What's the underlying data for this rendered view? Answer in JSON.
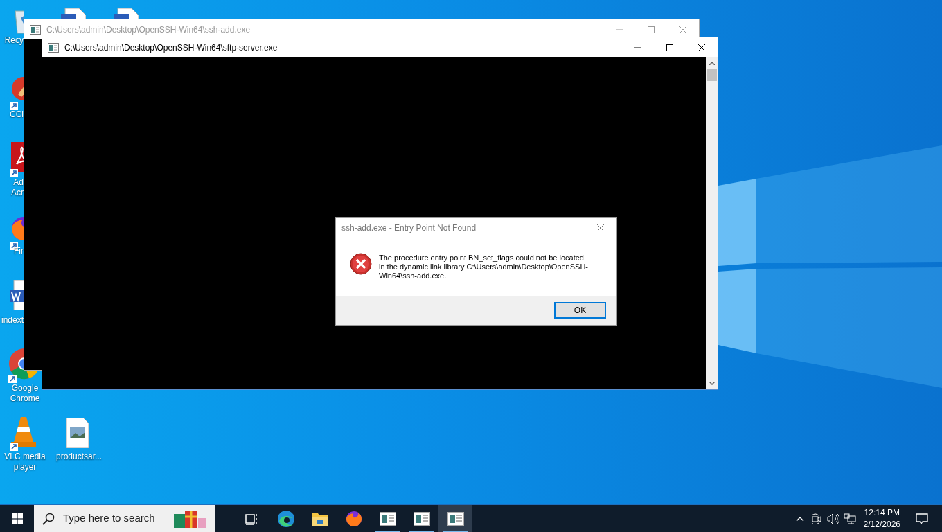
{
  "desktop_icons": [
    {
      "label": "Recy",
      "kind": "recycle",
      "shortcut": false
    },
    {
      "label": "CCl",
      "kind": "ccleaner",
      "shortcut": true
    },
    {
      "label": "Ad Acr",
      "kind": "acrobat",
      "shortcut": true
    },
    {
      "label": "Fir",
      "kind": "firefox",
      "shortcut": true
    },
    {
      "label": "indext",
      "kind": "word",
      "shortcut": false
    },
    {
      "label": "Google Chrome",
      "kind": "chrome",
      "shortcut": true
    },
    {
      "label": "VLC media player",
      "kind": "vlc",
      "shortcut": true
    },
    {
      "label": "productsar...",
      "kind": "image",
      "shortcut": false
    },
    {
      "kind": "worddoc",
      "shortcut": false
    },
    {
      "kind": "worddoc",
      "shortcut": false
    }
  ],
  "windows": [
    {
      "title": "C:\\Users\\admin\\Desktop\\OpenSSH-Win64\\ssh-add.exe",
      "active": false
    },
    {
      "title": "C:\\Users\\admin\\Desktop\\OpenSSH-Win64\\sftp-server.exe",
      "active": true
    }
  ],
  "dialog": {
    "title": "ssh-add.exe - Entry Point Not Found",
    "message": "The procedure entry point BN_set_flags could not be located in the dynamic link library C:\\Users\\admin\\Desktop\\OpenSSH-Win64\\ssh-add.exe.",
    "button": "OK"
  },
  "taskbar": {
    "search": {
      "placeholder": "Type here to search"
    },
    "apps": [
      {
        "kind": "taskview",
        "active": false,
        "running": false
      },
      {
        "kind": "edge",
        "active": false,
        "running": false
      },
      {
        "kind": "explorer",
        "active": false,
        "running": false
      },
      {
        "kind": "firefox",
        "active": false,
        "running": false
      },
      {
        "kind": "console",
        "active": false,
        "running": true
      },
      {
        "kind": "console",
        "active": false,
        "running": true
      },
      {
        "kind": "console",
        "active": true,
        "running": true
      }
    ],
    "clock": {
      "time": "12:14 PM",
      "date": "2/12/2026"
    }
  }
}
